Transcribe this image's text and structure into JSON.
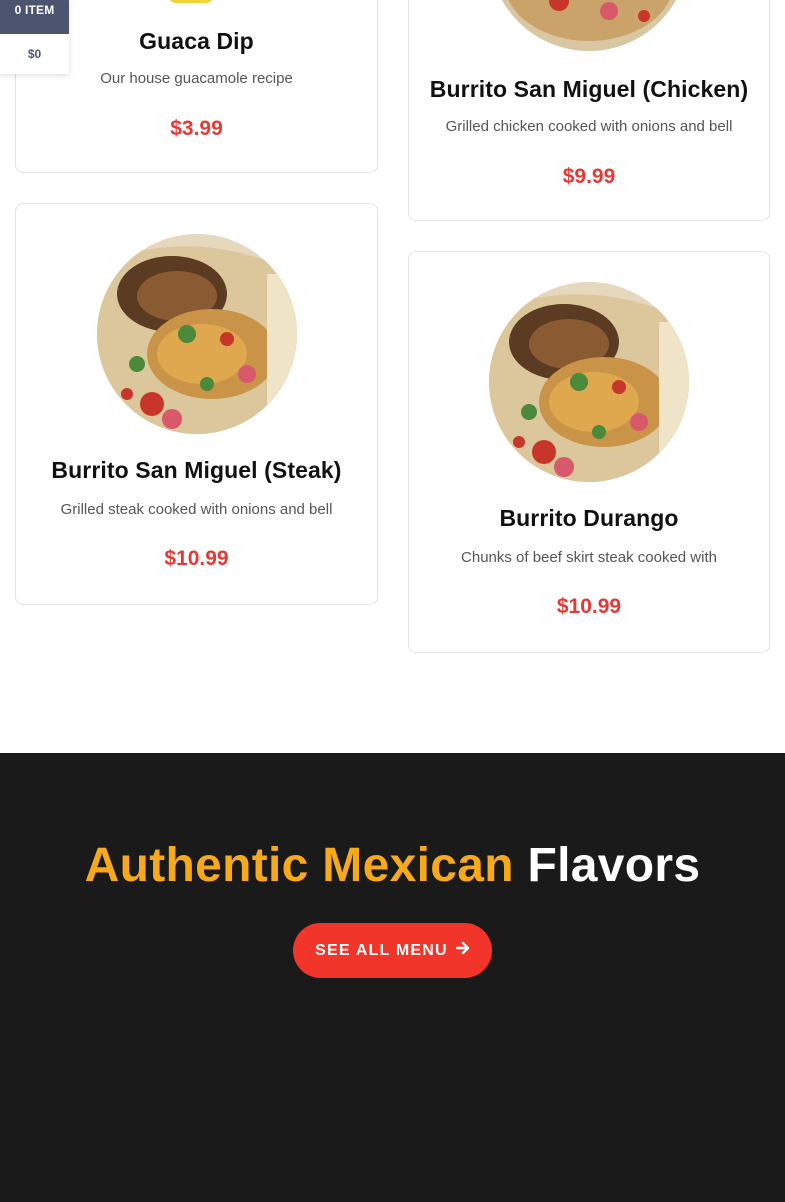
{
  "cart": {
    "count_label": "0 ITEM",
    "total": "$0"
  },
  "menu": {
    "items": [
      {
        "title": "Guaca Dip",
        "description": "Our house guacamole recipe",
        "price": "$3.99"
      },
      {
        "title": "Burrito San Miguel (Chicken)",
        "description": "Grilled chicken cooked with onions and bell",
        "price": "$9.99"
      },
      {
        "title": "Burrito San Miguel (Steak)",
        "description": "Grilled steak cooked with onions and bell",
        "price": "$10.99"
      },
      {
        "title": "Burrito Durango",
        "description": "Chunks of beef skirt steak cooked with",
        "price": "$10.99"
      }
    ]
  },
  "band": {
    "heading_highlight": "Authentic Mexican",
    "heading_rest": "Flavors",
    "cta_label": "SEE ALL MENU",
    "cta_icon": "arrow-right-icon"
  },
  "colors": {
    "accent_red": "#e53935",
    "cta_red": "#f2352a",
    "highlight_yellow": "#f5a91b",
    "band_bg": "#1b1a1b",
    "cart_bg": "#4c5470"
  }
}
